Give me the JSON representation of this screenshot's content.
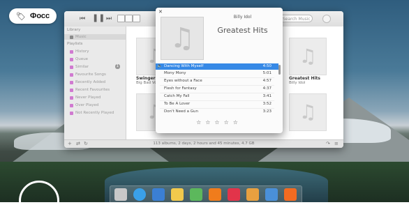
{
  "badge": {
    "icon": "tag-icon",
    "label": "Фосс"
  },
  "music_window": {
    "toolbar": {
      "prev_icon": "skip-back-icon",
      "pause_icon": "pause-icon",
      "next_icon": "skip-forward-icon",
      "search_placeholder": "Search Music",
      "search_icon": "search-icon"
    },
    "sidebar": {
      "library_header": "Library",
      "playlists_header": "Playlists",
      "items": [
        {
          "label": "Music",
          "icon": "music-note-icon",
          "color": "#8a8a8a"
        },
        {
          "label": "History",
          "icon": "history-icon",
          "color": "#d07ad0"
        },
        {
          "label": "Queue",
          "icon": "queue-icon",
          "color": "#d07ad0"
        },
        {
          "label": "Similar",
          "icon": "similar-icon",
          "color": "#d07ad0",
          "count": "1"
        },
        {
          "label": "Favourite Songs",
          "icon": "smart-playlist-icon",
          "color": "#d07ad0"
        },
        {
          "label": "Recently Added",
          "icon": "smart-playlist-icon",
          "color": "#d07ad0"
        },
        {
          "label": "Recent Favourites",
          "icon": "smart-playlist-icon",
          "color": "#d07ad0"
        },
        {
          "label": "Never Played",
          "icon": "smart-playlist-icon",
          "color": "#d07ad0"
        },
        {
          "label": "Over Played",
          "icon": "smart-playlist-icon",
          "color": "#d07ad0"
        },
        {
          "label": "Not Recently Played",
          "icon": "smart-playlist-icon",
          "color": "#d07ad0"
        }
      ]
    },
    "albums": [
      {
        "title": "Swingers S",
        "artist": "Big Bad Voo"
      },
      {
        "title": "Greatest Hits",
        "artist": "Billy Idol"
      }
    ],
    "status_text": "113 albums, 2 days, 2 hours and 45 minutes, 4.7 GB"
  },
  "album_popover": {
    "artist": "Billy Idol",
    "title": "Greatest Hits",
    "tracks": [
      {
        "name": "Dancing With Myself",
        "time": "4:50",
        "playing": true
      },
      {
        "name": "Mony Mony",
        "time": "5:01"
      },
      {
        "name": "Eyes without a Face",
        "time": "4:57"
      },
      {
        "name": "Flesh for Fantasy",
        "time": "4:37"
      },
      {
        "name": "Catch My Fall",
        "time": "3:41"
      },
      {
        "name": "To Be A Lover",
        "time": "3:52"
      },
      {
        "name": "Don't Need a Gun",
        "time": "3:23"
      }
    ],
    "rating_stars": 5
  },
  "dock": [
    {
      "name": "files-icon",
      "color": "#c8c8c8"
    },
    {
      "name": "browser-icon",
      "color": "#3aa0e8"
    },
    {
      "name": "tiles-icon",
      "color": "#3b7fd4"
    },
    {
      "name": "mail-icon",
      "color": "#f2c94c"
    },
    {
      "name": "spreadsheet-icon",
      "color": "#5cb85c"
    },
    {
      "name": "music-icon",
      "color": "#f07c1c"
    },
    {
      "name": "media-icon",
      "color": "#e2344a"
    },
    {
      "name": "photos-icon",
      "color": "#e8a040"
    },
    {
      "name": "video-icon",
      "color": "#4a90d9"
    },
    {
      "name": "store-icon",
      "color": "#f36b21"
    }
  ]
}
